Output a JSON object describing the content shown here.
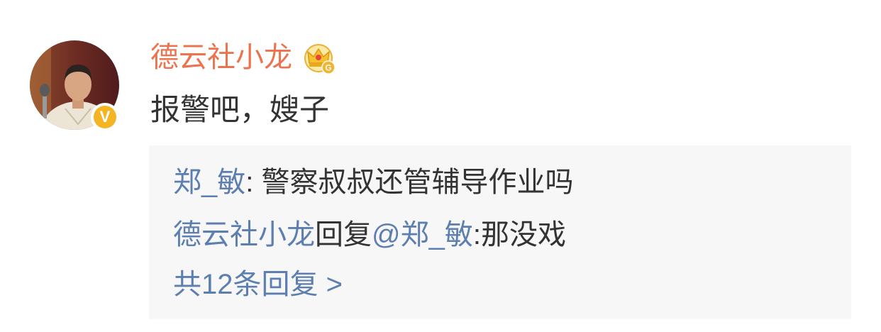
{
  "colors": {
    "author_orange": "#eb7350",
    "link_blue": "#5d7fb0",
    "text": "#333333",
    "reply_bg": "#f7f7f7",
    "verified_yellow": "#f5b422"
  },
  "comment": {
    "author": "德云社小龙",
    "author_badge_icon": "crown-vip-icon",
    "author_badge_letter": "G",
    "avatar_icon": "user-avatar",
    "verified_icon": "verified-v-icon",
    "verified_label": "V",
    "text": "报警吧，嫂子"
  },
  "replies": [
    {
      "author": "郑_敏",
      "content": ": 警察叔叔还管辅导作业吗"
    },
    {
      "author": "德云社小龙",
      "action": "回复",
      "mention": "@郑_敏",
      "content": ":那没戏"
    }
  ],
  "more_replies": "共12条回复 >"
}
